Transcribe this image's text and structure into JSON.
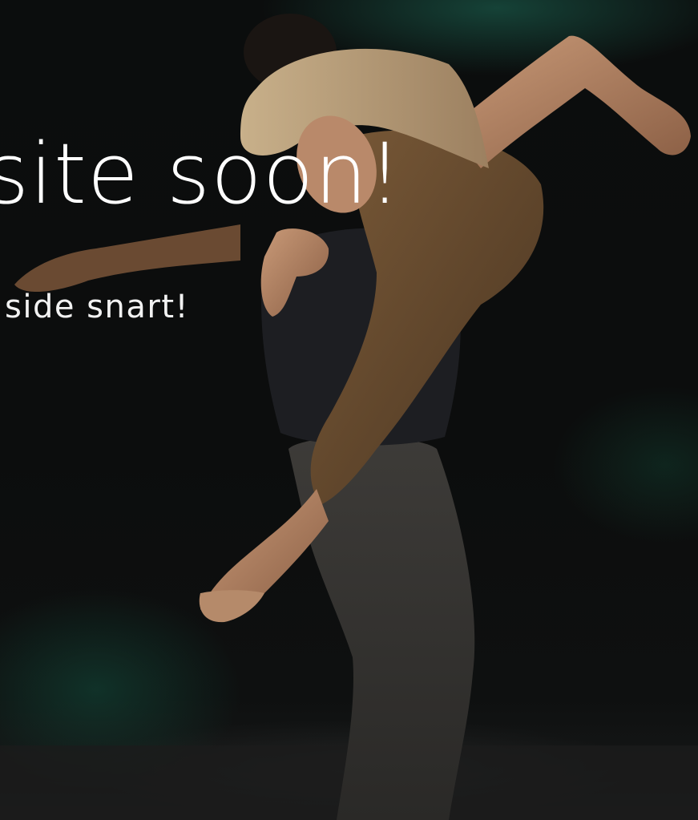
{
  "hero": {
    "headline": "site soon!",
    "subheadline": "side snart!"
  },
  "colors": {
    "background": "#0a0b0b",
    "accent_glow": "#1e6e5a",
    "text": "#ffffff"
  },
  "image": {
    "subject": "dancers-photo"
  }
}
